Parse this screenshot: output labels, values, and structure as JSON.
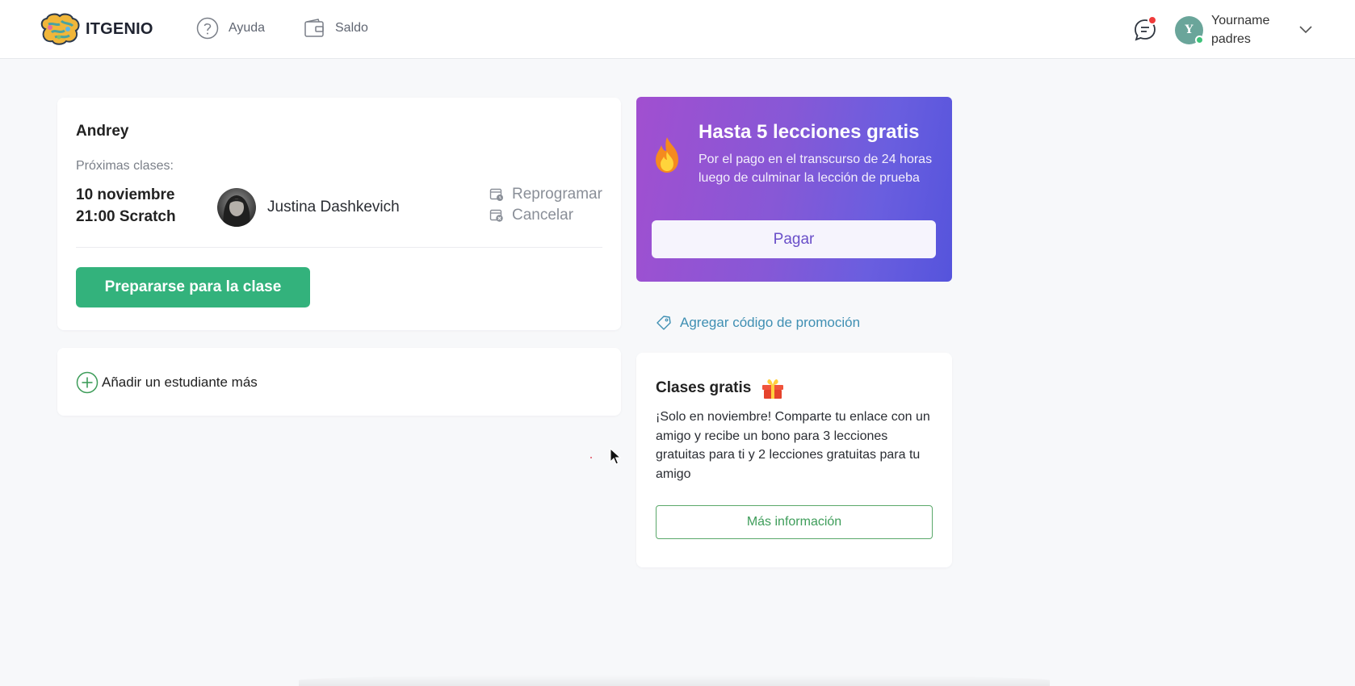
{
  "header": {
    "logo_text": "ITGENIO",
    "nav": [
      {
        "label": "Ayuda",
        "icon": "help-circle-icon"
      },
      {
        "label": "Saldo",
        "icon": "wallet-icon"
      }
    ],
    "user": {
      "initial": "Y",
      "name": "Yourname",
      "role": "padres"
    },
    "colors": {
      "notification_dot": "#ef3b3b",
      "online": "#3ec27a"
    }
  },
  "student_card": {
    "name": "Andrey",
    "next_label": "Próximas clases:",
    "date": "10 noviembre",
    "time_course": "21:00 Scratch",
    "teacher": "Justina Dashkevich",
    "reschedule_label": "Reprogramar",
    "cancel_label": "Cancelar",
    "prepare_label": "Prepararse para la clase",
    "accent": "#33b27c"
  },
  "add_student": {
    "label": "Añadir un estudiante más"
  },
  "promo_banner": {
    "title": "Hasta 5 lecciones gratis",
    "description": "Por el pago en el transcurso de 24 horas luego de culminar la lección de prueba",
    "pay_label": "Pagar"
  },
  "promo_code": {
    "label": "Agregar código de promoción"
  },
  "free_classes": {
    "title": "Clases gratis",
    "description": "¡Solo en noviembre! Comparte tu enlace con un amigo y recibe un bono para 3 lecciones gratuitas para ti y 2 lecciones gratuitas para tu amigo",
    "more_label": "Más información"
  }
}
